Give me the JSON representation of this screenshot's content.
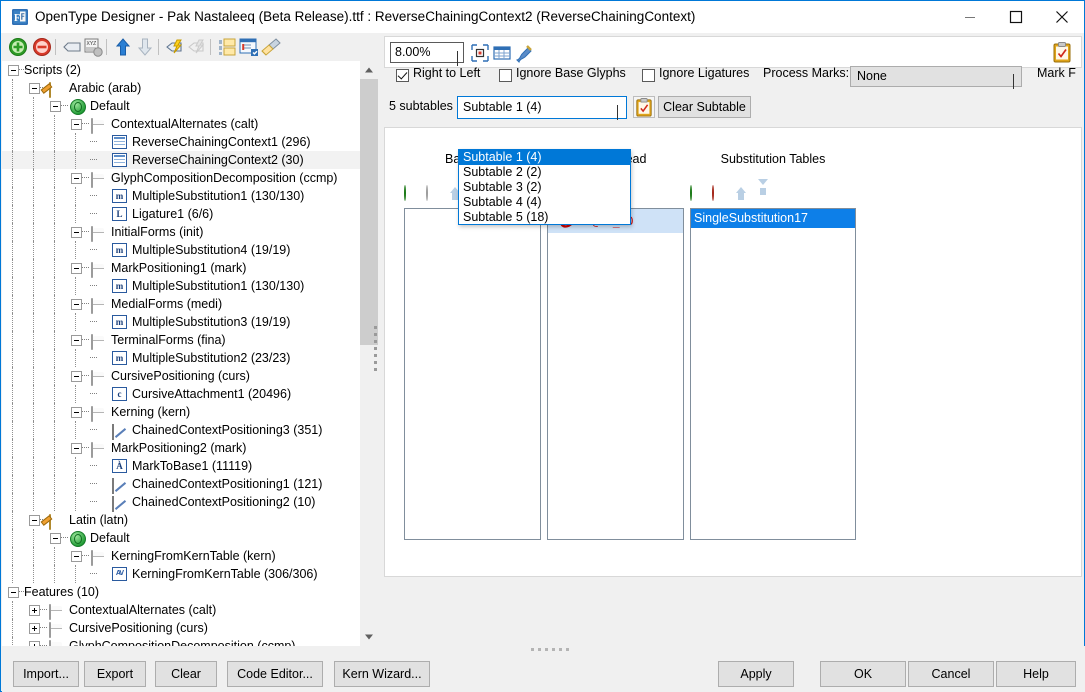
{
  "window": {
    "title": "OpenType Designer - Pak Nastaleeq (Beta Release).ttf : ReverseChainingContext2 (ReverseChainingContext)",
    "app_icon": "opentype-designer-icon",
    "minimize_label": "Minimize",
    "maximize_label": "Maximize",
    "close_label": "Close"
  },
  "left_toolbar": {
    "items": [
      {
        "name": "add-icon",
        "label": "Add"
      },
      {
        "name": "remove-icon",
        "label": "Remove"
      },
      {
        "name": "tag-icon",
        "label": "Tag"
      },
      {
        "name": "glyph-xyz-icon",
        "label": "Glyph XYZ"
      },
      {
        "name": "move-up-icon",
        "label": "Move Up"
      },
      {
        "name": "move-down-icon",
        "label": "Move Down"
      },
      {
        "name": "compile-icon",
        "label": "Compile"
      },
      {
        "name": "compile-disabled-icon",
        "label": "Compile All"
      },
      {
        "name": "copy-table-icon",
        "label": "Copy Table"
      },
      {
        "name": "report-icon",
        "label": "Report"
      },
      {
        "name": "clean-icon",
        "label": "Clean"
      }
    ]
  },
  "tree": {
    "nodes": [
      {
        "label": "Scripts (2)",
        "depth": 0,
        "icon": "none",
        "expander": "minus",
        "selected": false
      },
      {
        "label": "Arabic (arab)",
        "depth": 1,
        "icon": "script",
        "expander": "minus",
        "selected": false
      },
      {
        "label": "Default",
        "depth": 2,
        "icon": "globe",
        "expander": "minus",
        "selected": false
      },
      {
        "label": "ContextualAlternates (calt)",
        "depth": 3,
        "icon": "pkg",
        "expander": "minus",
        "selected": false
      },
      {
        "label": "ReverseChainingContext1 (296)",
        "depth": 4,
        "icon": "grid",
        "expander": "none",
        "selected": false
      },
      {
        "label": "ReverseChainingContext2 (30)",
        "depth": 4,
        "icon": "grid",
        "expander": "none",
        "selected": true
      },
      {
        "label": "GlyphCompositionDecomposition (ccmp)",
        "depth": 3,
        "icon": "pkg",
        "expander": "minus",
        "selected": false
      },
      {
        "label": "MultipleSubstitution1 (130/130)",
        "depth": 4,
        "icon": "m",
        "expander": "none",
        "selected": false
      },
      {
        "label": "Ligature1 (6/6)",
        "depth": 4,
        "icon": "L",
        "expander": "none",
        "selected": false
      },
      {
        "label": "InitialForms (init)",
        "depth": 3,
        "icon": "pkg",
        "expander": "minus",
        "selected": false
      },
      {
        "label": "MultipleSubstitution4 (19/19)",
        "depth": 4,
        "icon": "m",
        "expander": "none",
        "selected": false
      },
      {
        "label": "MarkPositioning1 (mark)",
        "depth": 3,
        "icon": "pkg",
        "expander": "minus",
        "selected": false
      },
      {
        "label": "MultipleSubstitution1 (130/130)",
        "depth": 4,
        "icon": "m",
        "expander": "none",
        "selected": false
      },
      {
        "label": "MedialForms (medi)",
        "depth": 3,
        "icon": "pkg",
        "expander": "minus",
        "selected": false
      },
      {
        "label": "MultipleSubstitution3 (19/19)",
        "depth": 4,
        "icon": "m",
        "expander": "none",
        "selected": false
      },
      {
        "label": "TerminalForms (fina)",
        "depth": 3,
        "icon": "pkg",
        "expander": "minus",
        "selected": false
      },
      {
        "label": "MultipleSubstitution2 (23/23)",
        "depth": 4,
        "icon": "m",
        "expander": "none",
        "selected": false
      },
      {
        "label": "CursivePositioning (curs)",
        "depth": 3,
        "icon": "pkg",
        "expander": "minus",
        "selected": false
      },
      {
        "label": "CursiveAttachment1 (20496)",
        "depth": 4,
        "icon": "C",
        "expander": "none",
        "selected": false
      },
      {
        "label": "Kerning (kern)",
        "depth": 3,
        "icon": "pkg",
        "expander": "minus",
        "selected": false
      },
      {
        "label": "ChainedContextPositioning3 (351)",
        "depth": 4,
        "icon": "pen",
        "expander": "none",
        "selected": false
      },
      {
        "label": "MarkPositioning2 (mark)",
        "depth": 3,
        "icon": "pkg",
        "expander": "minus",
        "selected": false
      },
      {
        "label": "MarkToBase1 (11119)",
        "depth": 4,
        "icon": "A",
        "expander": "none",
        "selected": false
      },
      {
        "label": "ChainedContextPositioning1 (121)",
        "depth": 4,
        "icon": "pen",
        "expander": "none",
        "selected": false
      },
      {
        "label": "ChainedContextPositioning2 (10)",
        "depth": 4,
        "icon": "pen",
        "expander": "none",
        "selected": false
      },
      {
        "label": "Latin (latn)",
        "depth": 1,
        "icon": "script",
        "expander": "minus",
        "selected": false
      },
      {
        "label": "Default",
        "depth": 2,
        "icon": "globe",
        "expander": "minus",
        "selected": false
      },
      {
        "label": "KerningFromKernTable (kern)",
        "depth": 3,
        "icon": "pkg",
        "expander": "minus",
        "selected": false
      },
      {
        "label": "KerningFromKernTable (306/306)",
        "depth": 4,
        "icon": "av",
        "expander": "none",
        "selected": false
      },
      {
        "label": "Features (10)",
        "depth": 0,
        "icon": "none",
        "expander": "minus",
        "selected": false
      },
      {
        "label": "ContextualAlternates (calt)",
        "depth": 1,
        "icon": "pkg",
        "expander": "plus",
        "selected": false
      },
      {
        "label": "CursivePositioning (curs)",
        "depth": 1,
        "icon": "pkg",
        "expander": "plus",
        "selected": false
      },
      {
        "label": "GlyphCompositionDecomposition (ccmp)",
        "depth": 1,
        "icon": "pkg",
        "expander": "plus",
        "selected": false
      }
    ]
  },
  "editor_toolbar": {
    "zoom_value": "8.00%",
    "icons": [
      {
        "name": "fit-to-window-icon",
        "label": "Fit"
      },
      {
        "name": "grid-view-icon",
        "label": "Grid"
      },
      {
        "name": "pen-tool-icon",
        "label": "Pen"
      }
    ],
    "clipboard_icon": "clipboard-check-icon"
  },
  "options": {
    "right_to_left": {
      "label": "Right to Left",
      "checked": true
    },
    "ignore_base_glyphs": {
      "label": "Ignore Base Glyphs",
      "checked": false
    },
    "ignore_ligatures": {
      "label": "Ignore Ligatures",
      "checked": false
    },
    "process_marks_label": "Process Marks:",
    "process_marks_value": "None",
    "process_marks_options": [
      "None"
    ],
    "mark_filter_label": "Mark F"
  },
  "subtable_bar": {
    "count_label": "5 subtables",
    "selected": "Subtable 1 (4)",
    "clipboard_icon": "clipboard-check-icon",
    "clear_button": "Clear Subtable",
    "options": [
      {
        "label": "Subtable 1 (4)",
        "selected": true
      },
      {
        "label": "Subtable 2 (2)",
        "selected": false
      },
      {
        "label": "Subtable 3 (2)",
        "selected": false
      },
      {
        "label": "Subtable 4 (4)",
        "selected": false
      },
      {
        "label": "Subtable 5 (18)",
        "selected": false
      }
    ]
  },
  "editor": {
    "columns": [
      {
        "header": "Backtrack",
        "items": []
      },
      {
        "header": "Lookahead",
        "items": [
          {
            "label": "@CG_10",
            "glyph": "arabic-glyph",
            "highlighted": true
          }
        ]
      },
      {
        "header": "Substitution Tables",
        "items": [
          {
            "label": "SingleSubstitution17",
            "selected": true
          }
        ]
      }
    ]
  },
  "bottom_buttons": {
    "left": [
      {
        "label": "Import...",
        "mnemonic": "I"
      },
      {
        "label": "Export",
        "mnemonic": "E"
      },
      {
        "label": "Clear",
        "mnemonic": ""
      },
      {
        "label": "Code Editor...",
        "mnemonic": ""
      },
      {
        "label": "Kern Wizard...",
        "mnemonic": ""
      }
    ],
    "right": [
      {
        "label": "Apply",
        "mnemonic": "A"
      },
      {
        "label": "OK",
        "mnemonic": "O"
      },
      {
        "label": "Cancel",
        "mnemonic": "C"
      },
      {
        "label": "Help",
        "mnemonic": "H"
      }
    ]
  },
  "colors": {
    "accent": "#0078d7",
    "selection": "#0d7fe8",
    "glyph_red": "#d00000",
    "highlight": "#cfe2f7"
  }
}
